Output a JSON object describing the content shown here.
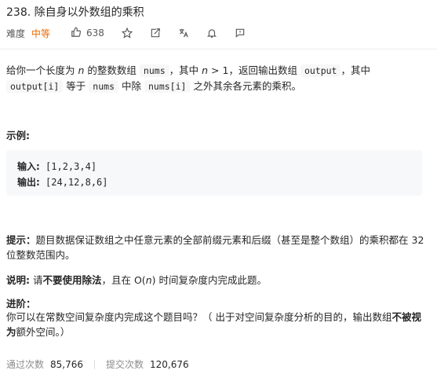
{
  "problem": {
    "title": "238. 除自身以外数组的乘积",
    "difficulty_label": "难度",
    "difficulty": "中等",
    "likes": "638"
  },
  "icons": [
    "thumbs-up-icon",
    "star-icon",
    "share-icon",
    "translate-icon",
    "bell-icon",
    "feedback-icon"
  ],
  "description": {
    "p1": "给你一个长度为",
    "n": "n",
    "p2": "的整数数组",
    "nums": "nums",
    "p3": "，其中",
    "n2": "n",
    "p4": "> 1，返回输出数组",
    "output": "output",
    "p5": "，其中",
    "output_i": "output[i]",
    "p6": "等于",
    "nums2": "nums",
    "p7": "中除",
    "nums_i": "nums[i]",
    "p8": "之外其余各元素的乘积。"
  },
  "example": {
    "heading": "示例:",
    "input_label": "输入:",
    "input_value": " [1,2,3,4]",
    "output_label": "输出:",
    "output_value": " [24,12,8,6]"
  },
  "hint": {
    "label": "提示：",
    "text": "题目数据保证数组之中任意元素的全部前缀元素和后缀（甚至是整个数组）的乘积都在 32 位整数范围内。"
  },
  "note": {
    "label": "说明:",
    "pre": " 请",
    "bold": "不要使用除法",
    "text": "，且在 O(",
    "n": "n",
    "post": ") 时间复杂度内完成此题。"
  },
  "advanced": {
    "heading": "进阶：",
    "text": "你可以在常数空间复杂度内完成这个题目吗？（ 出于对空间复杂度分析的目的，输出数组",
    "bold": "不被视为",
    "post": "额外空间。）"
  },
  "stats": {
    "passed_label": "通过次数",
    "passed_value": "85,766",
    "submitted_label": "提交次数",
    "submitted_value": "120,676"
  },
  "colors": {
    "difficulty": "#ef6c00",
    "code_bg": "#f7f7f7",
    "pre_bg": "#f7f8fa"
  }
}
